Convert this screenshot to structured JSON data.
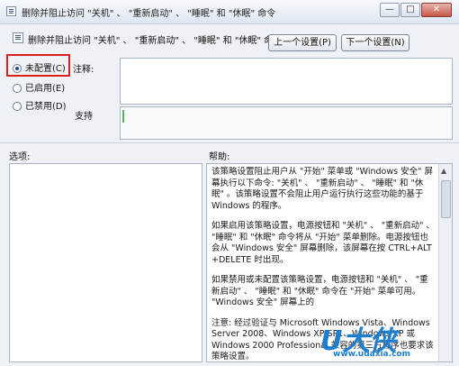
{
  "window": {
    "title": "删除并阻止访问 \"关机\" 、 \"重新启动\" 、 \"睡眠\" 和 \"休眠\" 命令",
    "min_glyph": "—",
    "max_glyph": "□",
    "close_glyph": "✕"
  },
  "header": {
    "title": "删除并阻止访问 \"关机\" 、 \"重新启动\" 、 \"睡眠\" 和 \"休眠\" 命令",
    "prev_button": "上一个设置(P)",
    "next_button": "下一个设置(N)"
  },
  "options": [
    {
      "label": "未配置(C)",
      "selected": true
    },
    {
      "label": "已启用(E)",
      "selected": false
    },
    {
      "label": "已禁用(D)",
      "selected": false
    }
  ],
  "comment_label": "注释:",
  "support_label": "支持",
  "sections": {
    "options_label": "选项:",
    "help_label": "帮助:"
  },
  "help": {
    "p1": "该策略设置阻止用户从 \"开始\" 菜单或 \"Windows 安全\" 屏幕执行以下命令: \"关机\" 、 \"重新启动\" 、 \"睡眠\" 和 \"休眠\" 。该策略设置不会阻止用户运行执行这些功能的基于 Windows 的程序。",
    "p2": "如果启用该策略设置，电源按钮和 \"关机\" 、 \"重新启动\" 、 \"睡眠\" 和 \"休眠\" 命令将从 \"开始\" 菜单删除。电源按钮也会从 \"Windows 安全\" 屏幕删除，该屏幕在按 CTRL+ALT +DELETE 时出现。",
    "p3": "如果禁用或未配置该策略设置，电源按钮和 \"关机\" 、 \"重新启动\" 、 \"睡眠\" 和 \"休眠\" 命令在 \"开始\" 菜单可用。 \"Windows 安全\" 屏幕上的",
    "p4": "注意: 经过验证与 Microsoft Windows Vista、Windows Server 2008、Windows XP SP1、Windows XP 或 Windows 2000 Professional 兼容的第三方程序也要求该策略设置。"
  },
  "watermark": {
    "logo": "U大侠",
    "site": "www.udaxia.com"
  }
}
